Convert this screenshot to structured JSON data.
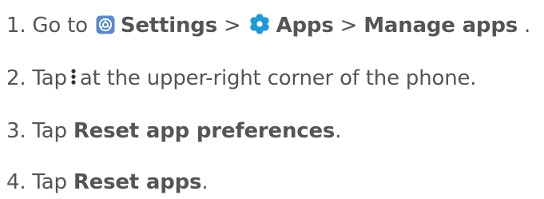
{
  "steps": [
    {
      "number": "1.",
      "text_go_to": "Go to",
      "settings": "Settings",
      "sep1": ">",
      "apps": "Apps",
      "sep2": ">",
      "manage_apps": "Manage apps",
      "end": ".",
      "icons": [
        "settings-icon",
        "apps-gear-icon"
      ]
    },
    {
      "number": "2.",
      "text_tap": "Tap",
      "text_rest": "at the upper-right corner of the phone.",
      "icons": [
        "more-vertical-icon"
      ]
    },
    {
      "number": "3.",
      "text_tap": "Tap",
      "bold": "Reset app preferences",
      "end": "."
    },
    {
      "number": "4.",
      "text_tap": "Tap",
      "bold": "Reset apps",
      "end": "."
    }
  ],
  "colors": {
    "text": "#555555",
    "settings_icon_bg": "#5b8ac5",
    "apps_icon": "#1f9ad8"
  }
}
